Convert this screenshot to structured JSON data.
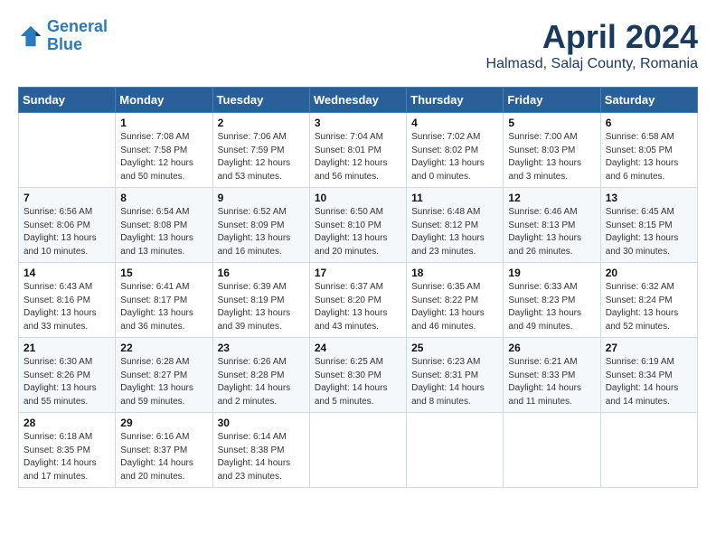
{
  "header": {
    "logo_line1": "General",
    "logo_line2": "Blue",
    "month": "April 2024",
    "location": "Halmasd, Salaj County, Romania"
  },
  "weekdays": [
    "Sunday",
    "Monday",
    "Tuesday",
    "Wednesday",
    "Thursday",
    "Friday",
    "Saturday"
  ],
  "weeks": [
    [
      {
        "day": "",
        "info": ""
      },
      {
        "day": "1",
        "info": "Sunrise: 7:08 AM\nSunset: 7:58 PM\nDaylight: 12 hours\nand 50 minutes."
      },
      {
        "day": "2",
        "info": "Sunrise: 7:06 AM\nSunset: 7:59 PM\nDaylight: 12 hours\nand 53 minutes."
      },
      {
        "day": "3",
        "info": "Sunrise: 7:04 AM\nSunset: 8:01 PM\nDaylight: 12 hours\nand 56 minutes."
      },
      {
        "day": "4",
        "info": "Sunrise: 7:02 AM\nSunset: 8:02 PM\nDaylight: 13 hours\nand 0 minutes."
      },
      {
        "day": "5",
        "info": "Sunrise: 7:00 AM\nSunset: 8:03 PM\nDaylight: 13 hours\nand 3 minutes."
      },
      {
        "day": "6",
        "info": "Sunrise: 6:58 AM\nSunset: 8:05 PM\nDaylight: 13 hours\nand 6 minutes."
      }
    ],
    [
      {
        "day": "7",
        "info": "Sunrise: 6:56 AM\nSunset: 8:06 PM\nDaylight: 13 hours\nand 10 minutes."
      },
      {
        "day": "8",
        "info": "Sunrise: 6:54 AM\nSunset: 8:08 PM\nDaylight: 13 hours\nand 13 minutes."
      },
      {
        "day": "9",
        "info": "Sunrise: 6:52 AM\nSunset: 8:09 PM\nDaylight: 13 hours\nand 16 minutes."
      },
      {
        "day": "10",
        "info": "Sunrise: 6:50 AM\nSunset: 8:10 PM\nDaylight: 13 hours\nand 20 minutes."
      },
      {
        "day": "11",
        "info": "Sunrise: 6:48 AM\nSunset: 8:12 PM\nDaylight: 13 hours\nand 23 minutes."
      },
      {
        "day": "12",
        "info": "Sunrise: 6:46 AM\nSunset: 8:13 PM\nDaylight: 13 hours\nand 26 minutes."
      },
      {
        "day": "13",
        "info": "Sunrise: 6:45 AM\nSunset: 8:15 PM\nDaylight: 13 hours\nand 30 minutes."
      }
    ],
    [
      {
        "day": "14",
        "info": "Sunrise: 6:43 AM\nSunset: 8:16 PM\nDaylight: 13 hours\nand 33 minutes."
      },
      {
        "day": "15",
        "info": "Sunrise: 6:41 AM\nSunset: 8:17 PM\nDaylight: 13 hours\nand 36 minutes."
      },
      {
        "day": "16",
        "info": "Sunrise: 6:39 AM\nSunset: 8:19 PM\nDaylight: 13 hours\nand 39 minutes."
      },
      {
        "day": "17",
        "info": "Sunrise: 6:37 AM\nSunset: 8:20 PM\nDaylight: 13 hours\nand 43 minutes."
      },
      {
        "day": "18",
        "info": "Sunrise: 6:35 AM\nSunset: 8:22 PM\nDaylight: 13 hours\nand 46 minutes."
      },
      {
        "day": "19",
        "info": "Sunrise: 6:33 AM\nSunset: 8:23 PM\nDaylight: 13 hours\nand 49 minutes."
      },
      {
        "day": "20",
        "info": "Sunrise: 6:32 AM\nSunset: 8:24 PM\nDaylight: 13 hours\nand 52 minutes."
      }
    ],
    [
      {
        "day": "21",
        "info": "Sunrise: 6:30 AM\nSunset: 8:26 PM\nDaylight: 13 hours\nand 55 minutes."
      },
      {
        "day": "22",
        "info": "Sunrise: 6:28 AM\nSunset: 8:27 PM\nDaylight: 13 hours\nand 59 minutes."
      },
      {
        "day": "23",
        "info": "Sunrise: 6:26 AM\nSunset: 8:28 PM\nDaylight: 14 hours\nand 2 minutes."
      },
      {
        "day": "24",
        "info": "Sunrise: 6:25 AM\nSunset: 8:30 PM\nDaylight: 14 hours\nand 5 minutes."
      },
      {
        "day": "25",
        "info": "Sunrise: 6:23 AM\nSunset: 8:31 PM\nDaylight: 14 hours\nand 8 minutes."
      },
      {
        "day": "26",
        "info": "Sunrise: 6:21 AM\nSunset: 8:33 PM\nDaylight: 14 hours\nand 11 minutes."
      },
      {
        "day": "27",
        "info": "Sunrise: 6:19 AM\nSunset: 8:34 PM\nDaylight: 14 hours\nand 14 minutes."
      }
    ],
    [
      {
        "day": "28",
        "info": "Sunrise: 6:18 AM\nSunset: 8:35 PM\nDaylight: 14 hours\nand 17 minutes."
      },
      {
        "day": "29",
        "info": "Sunrise: 6:16 AM\nSunset: 8:37 PM\nDaylight: 14 hours\nand 20 minutes."
      },
      {
        "day": "30",
        "info": "Sunrise: 6:14 AM\nSunset: 8:38 PM\nDaylight: 14 hours\nand 23 minutes."
      },
      {
        "day": "",
        "info": ""
      },
      {
        "day": "",
        "info": ""
      },
      {
        "day": "",
        "info": ""
      },
      {
        "day": "",
        "info": ""
      }
    ]
  ]
}
